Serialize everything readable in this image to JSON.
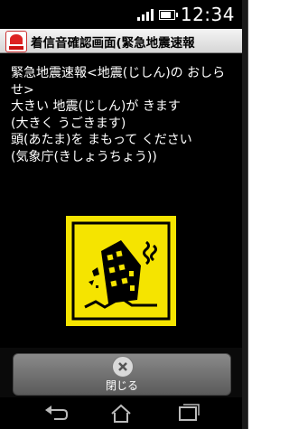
{
  "status": {
    "time": "12:34",
    "signal_icon": "signal-icon",
    "battery_icon": "battery-icon"
  },
  "app": {
    "title": "着信音確認画面(緊急地震速報"
  },
  "message": {
    "lines": [
      "緊急地震速報<地震(じしん)の おしら",
      "せ>",
      "大きい 地震(じしん)が きます",
      "(大きく うごきます)",
      "頭(あたま)を まもって ください",
      "(気象庁(きしょうちょう))"
    ]
  },
  "buttons": {
    "close_label": "閉じる"
  },
  "colors": {
    "sign_yellow": "#f5e400",
    "background": "#000000"
  }
}
